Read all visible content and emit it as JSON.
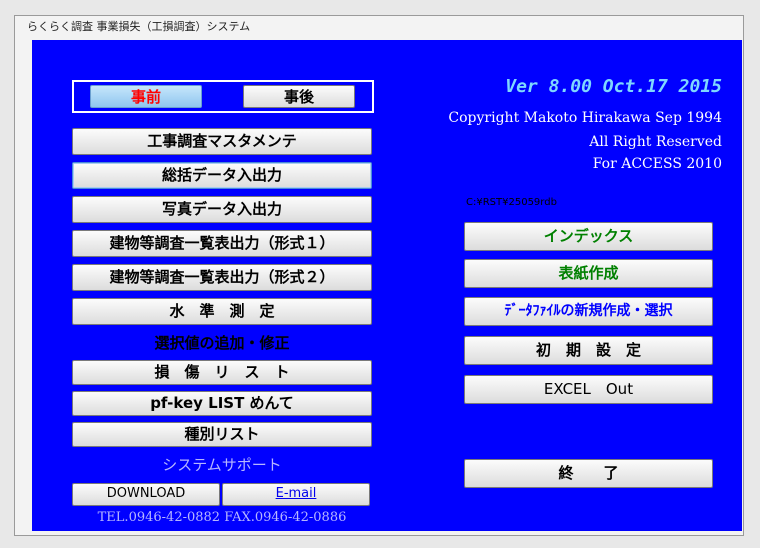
{
  "window": {
    "title": "らくらく調査 事業損失（工損調査）システム"
  },
  "toggle": {
    "before": "事前",
    "after": "事後",
    "colors": {
      "before_active": "#ff0000",
      "before_bg": "#aad5f4"
    }
  },
  "menu": {
    "items": [
      "工事調査マスタメンテ",
      "総括データ入出力",
      "写真データ入出力",
      "建物等調査一覧表出力（形式１）",
      "建物等調査一覧表出力（形式２）",
      "水　準　測　定"
    ],
    "section_label": "選択値の追加・修正",
    "items2": [
      "損　傷　リ　ス　ト",
      "pf-key LIST めんて",
      "種別リスト"
    ]
  },
  "support": {
    "label": "システムサポート",
    "download": "DOWNLOAD",
    "email": "E-mail",
    "contact": "TEL.0946-42-0882  FAX.0946-42-0886"
  },
  "info": {
    "version": "Ver 8.00 Oct.17 2015",
    "copyright": "Copyright Makoto Hirakawa Sep 1994",
    "rights": "All Right Reserved",
    "platform": "For ACCESS 2010",
    "path": "C:¥RST¥25059rdb"
  },
  "right_buttons": {
    "index": "インデックス",
    "cover": "表紙作成",
    "datafile": "ﾃﾞｰﾀﾌｧｲﾙの新規作成・選択",
    "initial": "初　期　設　定",
    "excel": "EXCEL　Out",
    "exit": "終　　了"
  }
}
